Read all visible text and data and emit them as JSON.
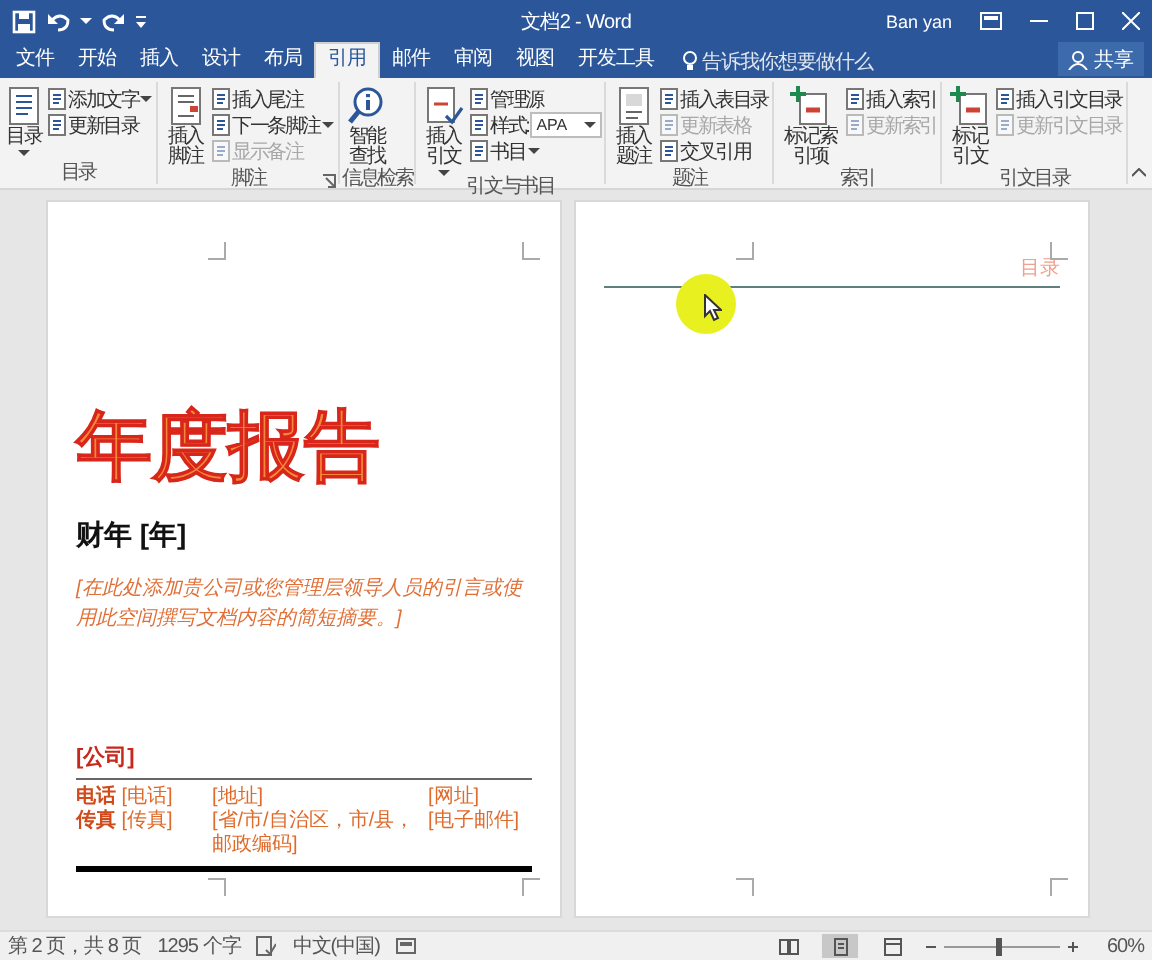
{
  "window": {
    "title": "文档2 - Word",
    "user": "Ban yan"
  },
  "tabs": [
    {
      "label": "文件",
      "selected": false
    },
    {
      "label": "开始",
      "selected": false
    },
    {
      "label": "插入",
      "selected": false
    },
    {
      "label": "设计",
      "selected": false
    },
    {
      "label": "布局",
      "selected": false
    },
    {
      "label": "引用",
      "selected": true
    },
    {
      "label": "邮件",
      "selected": false
    },
    {
      "label": "审阅",
      "selected": false
    },
    {
      "label": "视图",
      "selected": false
    },
    {
      "label": "开发工具",
      "selected": false
    }
  ],
  "tell_me": {
    "placeholder": "告诉我你想要做什么"
  },
  "share": "共享",
  "ribbon": {
    "groups": [
      {
        "label": "目录",
        "controls": [
          {
            "kind": "large",
            "label": "目录",
            "dropdown": true
          },
          {
            "kind": "stack",
            "items": [
              {
                "kind": "button",
                "label": "添加文字",
                "dropdown": true,
                "disabled": false
              },
              {
                "kind": "button",
                "label": "更新目录",
                "dropdown": false,
                "disabled": false
              }
            ]
          }
        ]
      },
      {
        "label": "脚注",
        "launcher": true,
        "controls": [
          {
            "kind": "large",
            "label": "插入脚注",
            "dropdown": false
          },
          {
            "kind": "stack",
            "items": [
              {
                "kind": "button",
                "label": "插入尾注",
                "dropdown": false,
                "disabled": false
              },
              {
                "kind": "button",
                "label": "下一条脚注",
                "dropdown": true,
                "disabled": false
              },
              {
                "kind": "button",
                "label": "显示备注",
                "dropdown": false,
                "disabled": true
              }
            ]
          }
        ]
      },
      {
        "label": "信息检索",
        "controls": [
          {
            "kind": "large",
            "label": "智能查找",
            "dropdown": false
          }
        ]
      },
      {
        "label": "引文与书目",
        "controls": [
          {
            "kind": "large",
            "label": "插入引文",
            "dropdown": true
          },
          {
            "kind": "stack",
            "items": [
              {
                "kind": "button",
                "label": "管理源",
                "dropdown": false,
                "disabled": false
              },
              {
                "kind": "select",
                "label": "样式:",
                "value": "APA"
              },
              {
                "kind": "button",
                "label": "书目",
                "dropdown": true,
                "disabled": false
              }
            ]
          }
        ]
      },
      {
        "label": "题注",
        "controls": [
          {
            "kind": "large",
            "label": "插入题注",
            "dropdown": false
          },
          {
            "kind": "stack",
            "items": [
              {
                "kind": "button",
                "label": "插入表目录",
                "dropdown": false,
                "disabled": false
              },
              {
                "kind": "button",
                "label": "更新表格",
                "dropdown": false,
                "disabled": true
              },
              {
                "kind": "button",
                "label": "交叉引用",
                "dropdown": false,
                "disabled": false
              }
            ]
          }
        ]
      },
      {
        "label": "索引",
        "controls": [
          {
            "kind": "large",
            "label": "标记索引项",
            "dropdown": false
          },
          {
            "kind": "stack",
            "items": [
              {
                "kind": "button",
                "label": "插入索引",
                "dropdown": false,
                "disabled": false
              },
              {
                "kind": "button",
                "label": "更新索引",
                "dropdown": false,
                "disabled": true
              }
            ]
          }
        ]
      },
      {
        "label": "引文目录",
        "controls": [
          {
            "kind": "large",
            "label": "标记引文",
            "dropdown": false
          },
          {
            "kind": "stack",
            "items": [
              {
                "kind": "button",
                "label": "插入引文目录",
                "dropdown": false,
                "disabled": false
              },
              {
                "kind": "button",
                "label": "更新引文目录",
                "dropdown": false,
                "disabled": true
              }
            ]
          }
        ]
      }
    ]
  },
  "pages": [
    {
      "kind": "cover",
      "title": "年度报告",
      "subtitle": "财年 [年]",
      "summary": "[在此处添加贵公司或您管理层领导人员的引言或使用此空间撰写文档内容的简短摘要。]",
      "company": "[公司]",
      "contact": [
        [
          "**电话** [电话]",
          "[地址]",
          "[网址]"
        ],
        [
          "**传真** [传真]",
          "[省/市/自治区，市/县，邮政编码]",
          "[电子邮件]"
        ]
      ]
    },
    {
      "kind": "toc",
      "header": "目录"
    }
  ],
  "status_bar": {
    "page": "第 2 页，共 8 页",
    "words": "1295 个字",
    "language": "中文(中国)",
    "views": [
      {
        "selected": false
      },
      {
        "selected": true
      },
      {
        "selected": false
      }
    ],
    "zoom": {
      "level": 0.45,
      "reading": "60%"
    }
  }
}
